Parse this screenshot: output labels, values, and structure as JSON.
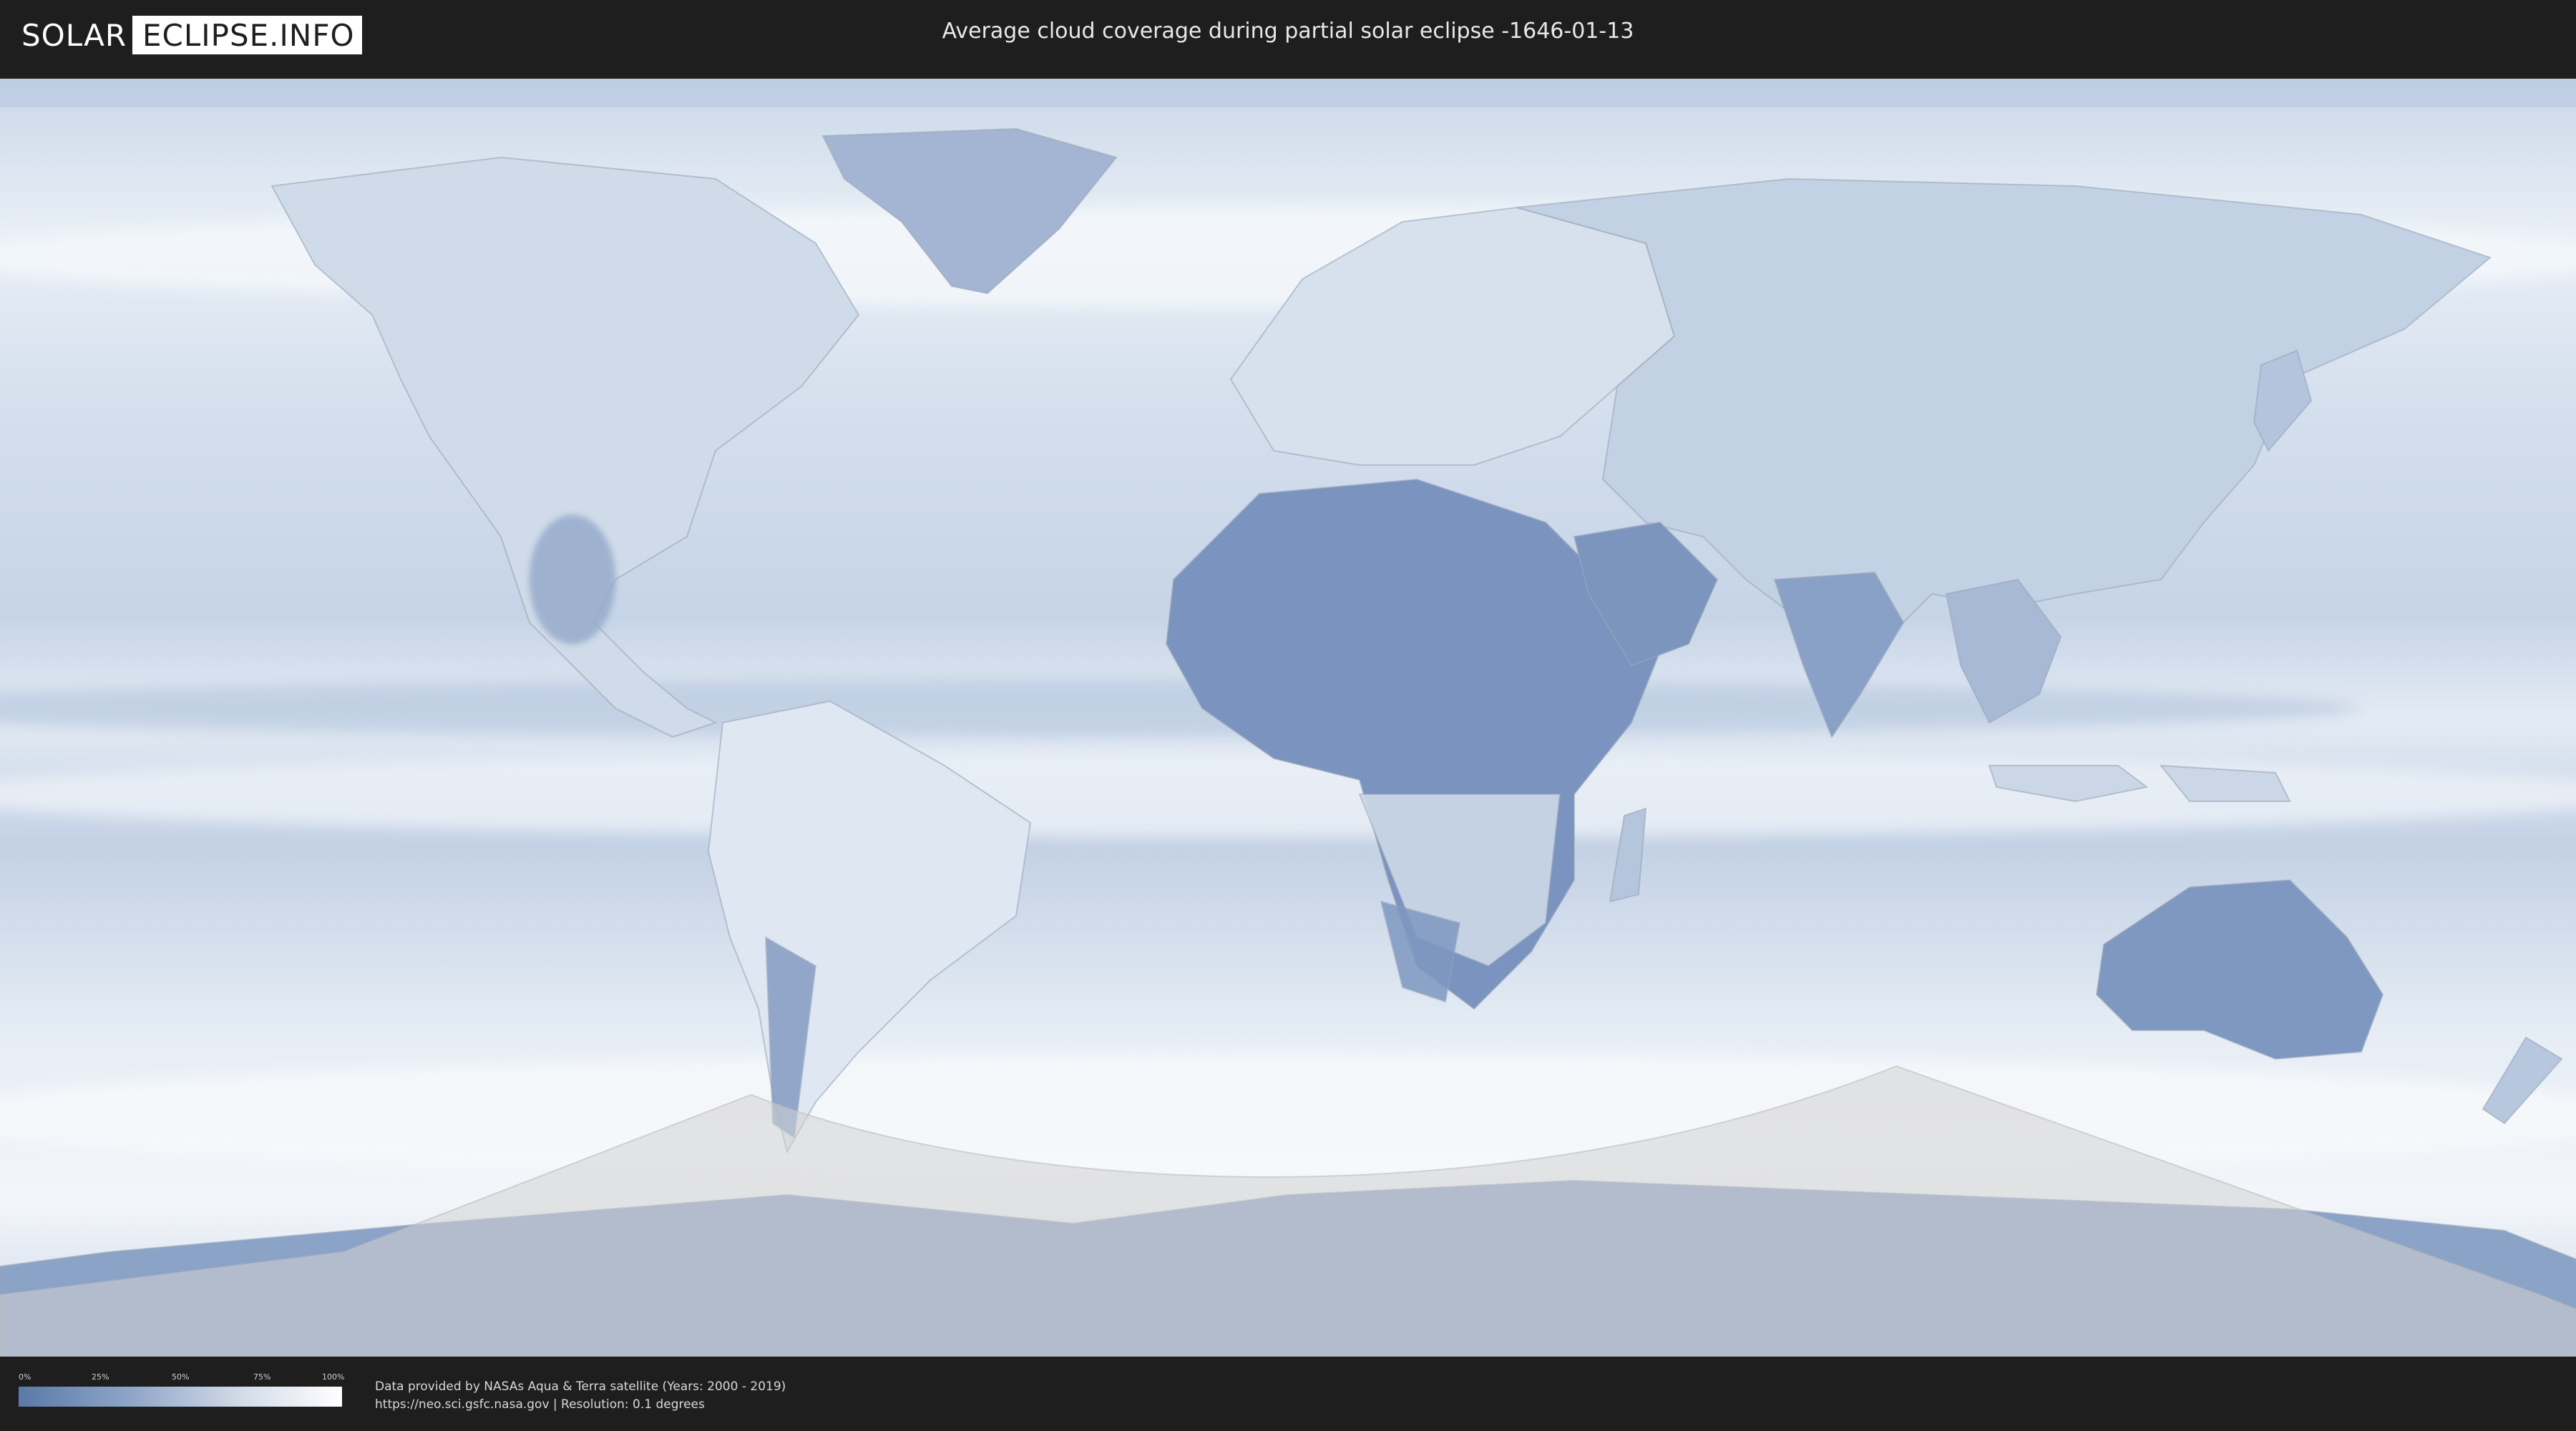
{
  "header": {
    "logo_part1": "SOLAR",
    "logo_part2": "ECLIPSE.INFO",
    "title": "Average cloud coverage during partial solar eclipse -1646-01-13"
  },
  "map": {
    "ocean_color": "#dfe8f2",
    "land_cloud_low_color": "#6e88b4",
    "eclipse_overlay_color": "#d2d2d2"
  },
  "legend": {
    "ticks": [
      "0%",
      "25%",
      "50%",
      "75%",
      "100%"
    ],
    "color_low": "#5b79a8",
    "color_high": "#ffffff"
  },
  "credits": {
    "line1": "Data provided by NASAs Aqua & Terra satellite (Years: 2000 - 2019)",
    "line2": "https://neo.sci.gsfc.nasa.gov | Resolution: 0.1 degrees"
  }
}
